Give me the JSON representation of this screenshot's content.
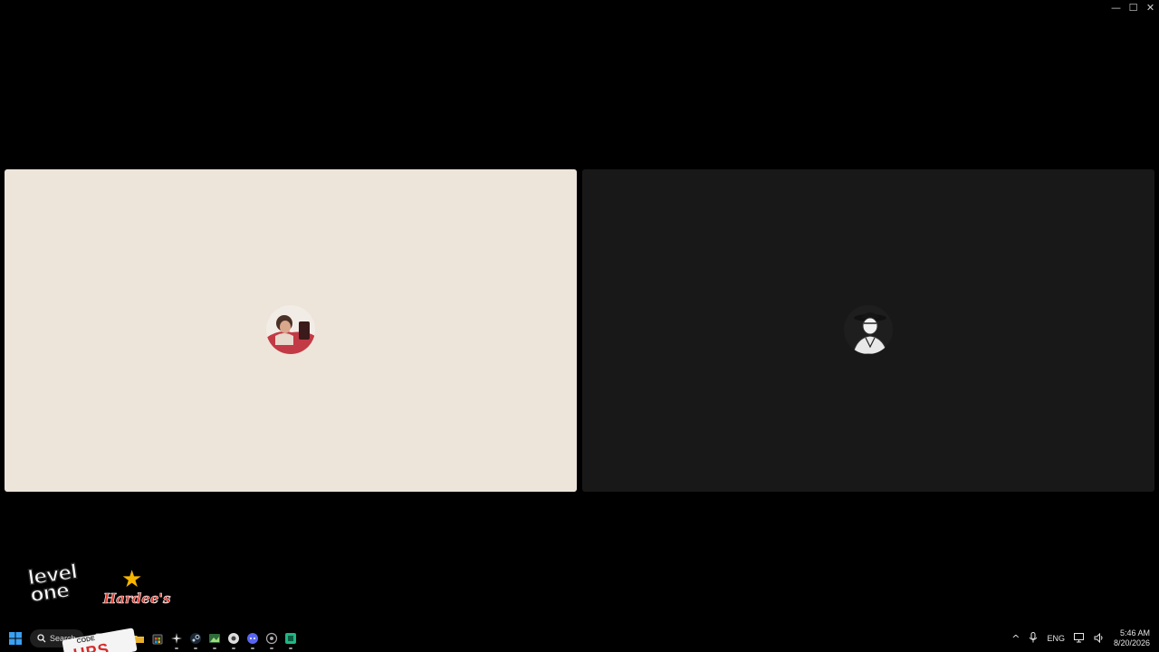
{
  "window": {
    "controls": {
      "minimize_glyph": "—",
      "maximize_glyph": "☐",
      "close_glyph": "✕"
    }
  },
  "call": {
    "participants": [
      {
        "tile_color": "#ede4da",
        "avatar_icon": "person-avatar-red"
      },
      {
        "tile_color": "#181818",
        "avatar_icon": "person-avatar-hat"
      }
    ]
  },
  "desktop": {
    "logos": {
      "levelone_line1": "level",
      "levelone_line2": "one",
      "hardees": "Hardee's"
    },
    "sticker": {
      "code": "CODE",
      "big": "UPS"
    }
  },
  "taskbar": {
    "search_label": "Search",
    "apps": [
      "task-view-icon",
      "browser-icon",
      "file-explorer-icon",
      "store-icon",
      "sparkle-app-icon",
      "steam-icon",
      "image-app-icon",
      "chrome-icon",
      "discord-icon",
      "game-app-icon",
      "spreadsheet-app-icon"
    ],
    "tray": {
      "chevron": "^",
      "mic_icon": "microphone-icon",
      "language": "ENG",
      "network_icon": "network-icon",
      "volume_icon": "volume-icon"
    },
    "clock": {
      "time": "5:46 AM",
      "date": "8/20/2026"
    }
  }
}
